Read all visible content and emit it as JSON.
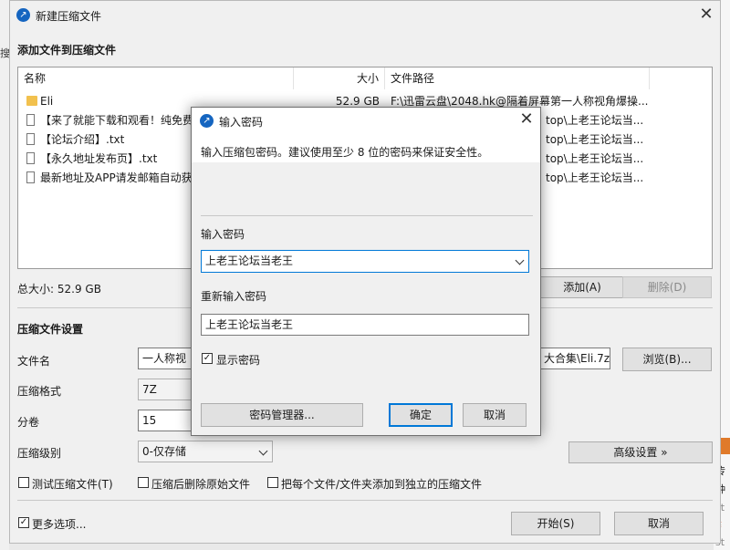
{
  "main_window": {
    "title": "新建压缩文件",
    "heading": "添加文件到压缩文件",
    "columns": {
      "name": "名称",
      "size": "大小",
      "path": "文件路径"
    },
    "files": [
      {
        "type": "folder",
        "name": "Eli",
        "size": "52.9 GB",
        "path": "F:\\迅雷云盘\\2048.hk@隔着屏幕第一人称视角爆操..."
      },
      {
        "type": "file",
        "name": "【来了就能下载和观看！纯免费",
        "size": "",
        "path": "top\\上老王论坛当..."
      },
      {
        "type": "file",
        "name": "【论坛介绍】.txt",
        "size": "",
        "path": "top\\上老王论坛当..."
      },
      {
        "type": "file",
        "name": "【永久地址发布页】.txt",
        "size": "",
        "path": "top\\上老王论坛当..."
      },
      {
        "type": "file",
        "name": "最新地址及APP请发邮箱自动获",
        "size": "",
        "path": "top\\上老王论坛当..."
      }
    ],
    "total_size": "总大小: 52.9 GB",
    "add_button": "添加(A)",
    "delete_button": "删除(D)",
    "settings_heading": "压缩文件设置",
    "filename_label": "文件名",
    "filename_value_left": "一人称视",
    "filename_value_right": "大合集\\Eli.7z",
    "browse_button": "浏览(B)...",
    "format_label": "压缩格式",
    "format_value": "7Z",
    "volume_label": "分卷",
    "volume_value": "15",
    "level_label": "压缩级别",
    "level_value": "0-仅存储",
    "advanced_button": "高级设置 »",
    "test_checkbox": "测试压缩文件(T)",
    "delete_after_checkbox": "压缩后删除原始文件",
    "separate_checkbox": "把每个文件/文件夹添加到独立的压缩文件",
    "more_options_checkbox": "更多选项...",
    "start_button": "开始(S)",
    "cancel_button": "取消"
  },
  "password_dialog": {
    "title": "输入密码",
    "description": "输入压缩包密码。建议使用至少 8 位的密码来保证安全性。",
    "password_label": "输入密码",
    "password_value": "上老王论坛当老王",
    "confirm_label": "重新输入密码",
    "confirm_value": "上老王论坛当老王",
    "show_password": "显示密码",
    "manager_button": "密码管理器...",
    "ok_button": "确定",
    "cancel_button": "取消"
  },
  "background": {
    "left_fragment": "搜",
    "right_fragments": [
      "传",
      "种",
      "st",
      "¥",
      "st"
    ]
  },
  "colors": {
    "accent": "#1565c0",
    "focus_border": "#0078d7",
    "folder": "#f2c14e"
  }
}
